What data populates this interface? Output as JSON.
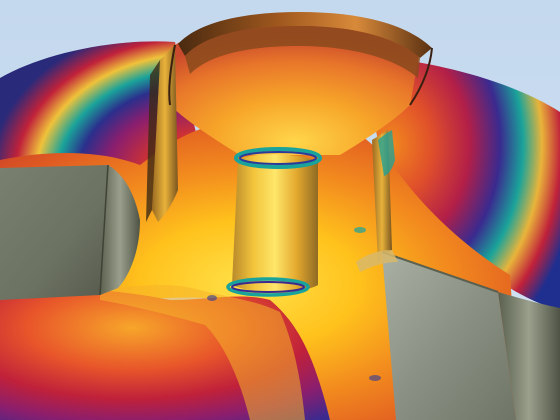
{
  "scene": {
    "subject": "cutaway-3d-field-simulation-render",
    "background_color": "#c7dbef",
    "colors": {
      "hot_yellow": "#ffd21a",
      "orange": "#f28a1e",
      "red": "#c0213a",
      "magenta": "#8a1e6e",
      "deep_blue": "#1f2f8f",
      "teal": "#1aa39a",
      "steel_gray": "#7f8676"
    }
  }
}
